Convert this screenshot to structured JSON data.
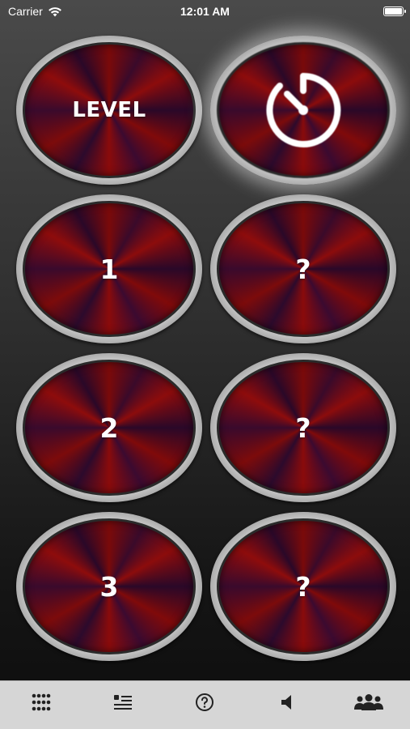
{
  "status_bar": {
    "carrier": "Carrier",
    "time": "12:01 AM"
  },
  "grid": {
    "buttons": [
      {
        "label": "LEVEL",
        "name": "level-button"
      },
      {
        "label": "",
        "name": "timer-button",
        "icon": "stopwatch-icon",
        "highlighted": true
      },
      {
        "label": "1",
        "name": "level-1-button"
      },
      {
        "label": "?",
        "name": "locked-button-1"
      },
      {
        "label": "2",
        "name": "level-2-button"
      },
      {
        "label": "?",
        "name": "locked-button-2"
      },
      {
        "label": "3",
        "name": "level-3-button"
      },
      {
        "label": "?",
        "name": "locked-button-3"
      }
    ]
  },
  "tab_bar": {
    "tabs": [
      {
        "icon": "grid-dots-icon"
      },
      {
        "icon": "list-icon"
      },
      {
        "icon": "question-circle-icon"
      },
      {
        "icon": "speaker-icon"
      },
      {
        "icon": "people-icon"
      }
    ]
  },
  "colors": {
    "button_red": "#8c0c0c",
    "button_purple": "#2a0828",
    "tab_bar_bg": "#d6d6d6",
    "tab_icon": "#222222"
  }
}
